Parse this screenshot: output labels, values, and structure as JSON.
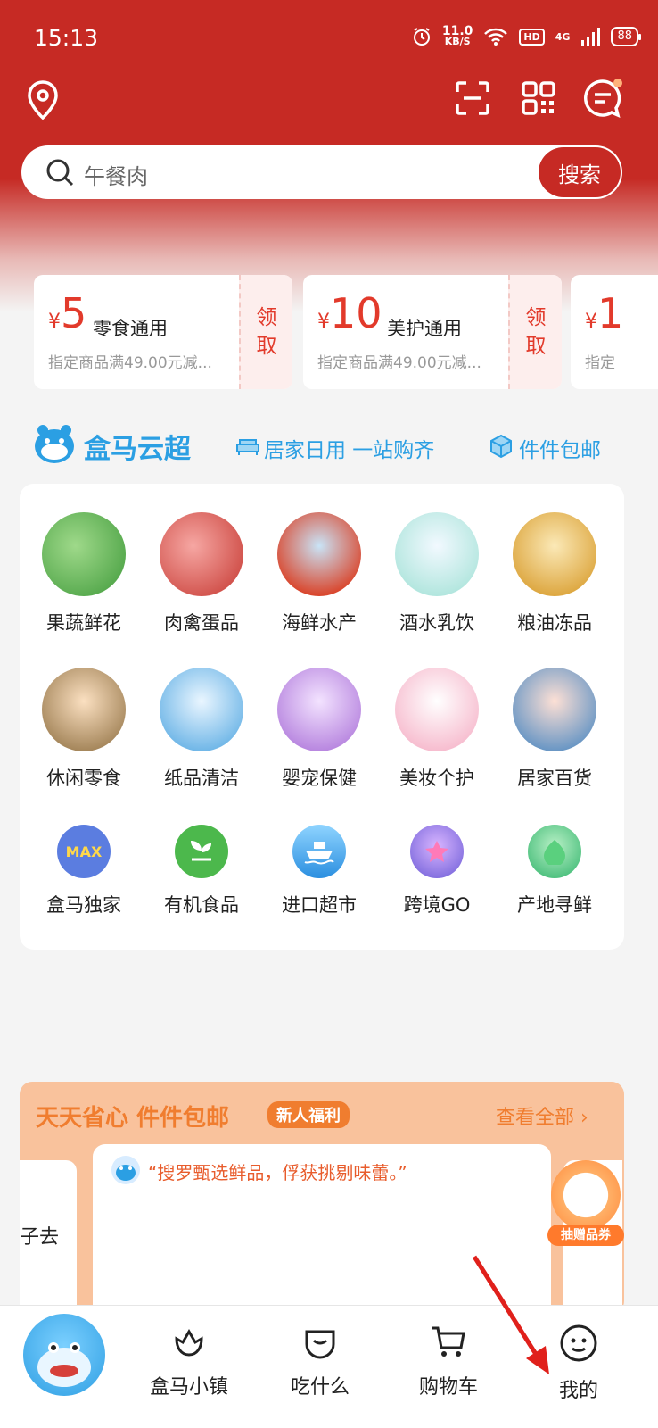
{
  "status_bar": {
    "time": "15:13",
    "speed_value": "11.0",
    "speed_unit": "KB/S",
    "hd_label": "HD",
    "network": "4G",
    "battery": "88"
  },
  "search": {
    "placeholder": "午餐肉",
    "button_label": "搜索"
  },
  "coupons": [
    {
      "currency": "¥",
      "amount": "5",
      "title": "零食通用",
      "desc": "指定商品满49.00元减...",
      "claim_1": "领",
      "claim_2": "取"
    },
    {
      "currency": "¥",
      "amount": "10",
      "title": "美护通用",
      "desc": "指定商品满49.00元减...",
      "claim_1": "领",
      "claim_2": "取"
    },
    {
      "currency": "¥",
      "amount": "1",
      "title": "",
      "desc": "指定",
      "claim_1": "",
      "claim_2": ""
    }
  ],
  "brand": {
    "name": "盒马云超",
    "slogan_1": "居家日用 一站购齐",
    "slogan_2": "件件包邮",
    "accent_color": "#2b9fe3"
  },
  "categories": [
    {
      "label": "果蔬鲜花",
      "icon": "vegetables-icon"
    },
    {
      "label": "肉禽蛋品",
      "icon": "meat-icon"
    },
    {
      "label": "海鲜水产",
      "icon": "seafood-icon"
    },
    {
      "label": "酒水乳饮",
      "icon": "drinks-icon"
    },
    {
      "label": "粮油冻品",
      "icon": "grain-oil-icon"
    },
    {
      "label": "休闲零食",
      "icon": "snacks-icon"
    },
    {
      "label": "纸品清洁",
      "icon": "cleaning-icon"
    },
    {
      "label": "婴宠保健",
      "icon": "baby-pet-icon"
    },
    {
      "label": "美妆个护",
      "icon": "beauty-icon"
    },
    {
      "label": "居家百货",
      "icon": "household-icon"
    },
    {
      "label": "盒马独家",
      "icon": "hema-max-icon",
      "icon_text": "MAX"
    },
    {
      "label": "有机食品",
      "icon": "organic-leaf-icon"
    },
    {
      "label": "进口超市",
      "icon": "import-ship-icon"
    },
    {
      "label": "跨境GO",
      "icon": "cross-border-icon"
    },
    {
      "label": "产地寻鲜",
      "icon": "origin-fresh-icon"
    }
  ],
  "promo": {
    "title": "天天省心 件件包邮",
    "badge": "新人福利",
    "more": "查看全部",
    "quote": "“搜罗甄选鲜品，俘获挑剔味蕾。”",
    "left_card_text": "子去",
    "float_badge": "抽赠品券",
    "color": "#f07d2f"
  },
  "tabbar": {
    "tabs": [
      {
        "label": "盒马小镇"
      },
      {
        "label": "吃什么"
      },
      {
        "label": "购物车"
      },
      {
        "label": "我的"
      }
    ]
  },
  "theme": {
    "primary": "#c62a24"
  }
}
